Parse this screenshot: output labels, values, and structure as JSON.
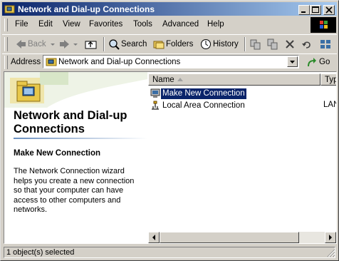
{
  "window": {
    "title": "Network and Dial-up Connections"
  },
  "menu": [
    "File",
    "Edit",
    "View",
    "Favorites",
    "Tools",
    "Advanced",
    "Help"
  ],
  "toolbar": {
    "back": "Back",
    "search": "Search",
    "folders": "Folders",
    "history": "History"
  },
  "address": {
    "label": "Address",
    "value": "Network and Dial-up Connections",
    "go": "Go"
  },
  "leftpane": {
    "heading": "Network and Dial-up Connections",
    "selected_title": "Make New Connection",
    "description": "The Network Connection wizard helps you create a new connection so that your computer can have access to other computers and networks."
  },
  "list": {
    "columns": [
      "Name",
      "Typ"
    ],
    "rows": [
      {
        "name": "Make New Connection",
        "type": "",
        "icon": "make-new-connection-icon",
        "selected": true
      },
      {
        "name": "Local Area Connection",
        "type": "LAN",
        "icon": "lan-connection-icon",
        "selected": false
      }
    ]
  },
  "status": {
    "text": "1 object(s) selected"
  },
  "colors": {
    "titlebar_start": "#0a246a",
    "titlebar_end": "#a6caf0",
    "selection": "#0a246a",
    "face": "#d4d0c8"
  }
}
